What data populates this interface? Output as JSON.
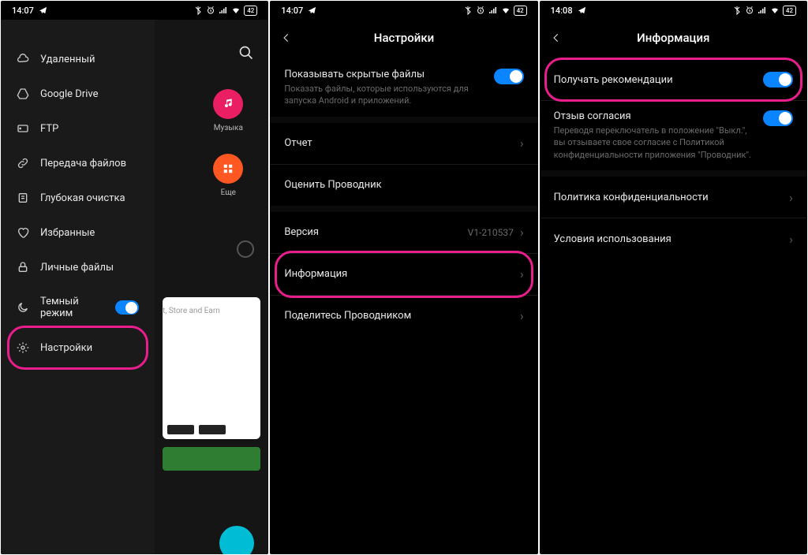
{
  "status": {
    "time1": "14:07",
    "time2": "14:07",
    "time3": "14:08",
    "battery": "42"
  },
  "screen1": {
    "drawer": {
      "items": [
        {
          "label": "Удаленный"
        },
        {
          "label": "Google Drive"
        },
        {
          "label": "FTP"
        },
        {
          "label": "Передача файлов"
        },
        {
          "label": "Глубокая очистка"
        },
        {
          "label": "Избранные"
        },
        {
          "label": "Личные файлы"
        },
        {
          "label": "Темный режим"
        },
        {
          "label": "Настройки"
        }
      ]
    },
    "back": {
      "music": "Музыка",
      "more": "Еще",
      "card_text": "t, Store and Earn"
    }
  },
  "screen2": {
    "title": "Настройки",
    "rows": {
      "hidden_title": "Показывать скрытые файлы",
      "hidden_sub": "Показать файлы, которые используются для запуска Android и приложений.",
      "report": "Отчет",
      "rate": "Оценить Проводник",
      "version": "Версия",
      "version_val": "V1-210537",
      "info": "Информация",
      "share": "Поделитесь Проводником"
    }
  },
  "screen3": {
    "title": "Информация",
    "rows": {
      "recommend": "Получать рекомендации",
      "revoke_title": "Отзыв согласия",
      "revoke_sub": "Переводя переключатель в положение \"Выкл.\", вы отзываете свое согласие с Политикой конфиденциальности приложения \"Проводник\".",
      "privacy": "Политика конфиденциальности",
      "terms": "Условия использования"
    }
  }
}
